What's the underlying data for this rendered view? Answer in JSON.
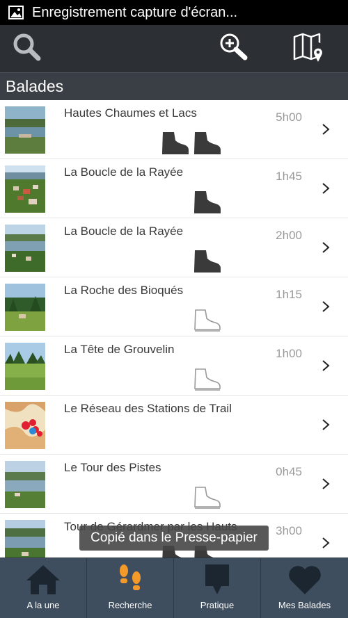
{
  "status_bar": {
    "notification": "Enregistrement capture d'écran..."
  },
  "toolbar": {
    "icons": [
      "search-icon",
      "zoom-in-icon",
      "map-icon"
    ]
  },
  "section": {
    "title": "Balades"
  },
  "walks": [
    {
      "title": "Hautes Chaumes et Lacs",
      "duration": "5h00",
      "difficulty": 2,
      "boots": [
        "filled",
        "filled"
      ],
      "thumb": "lake"
    },
    {
      "title": "La Boucle de la Rayée",
      "duration": "1h45",
      "difficulty": 1,
      "boots": [
        "filled"
      ],
      "thumb": "town"
    },
    {
      "title": "La Boucle de la Rayée",
      "duration": "2h00",
      "difficulty": 1,
      "boots": [
        "filled"
      ],
      "thumb": "lake2"
    },
    {
      "title": "La Roche des Bioqués",
      "duration": "1h15",
      "difficulty": 0,
      "boots": [
        "outline"
      ],
      "thumb": "forest"
    },
    {
      "title": "La Tête de Grouvelin",
      "duration": "1h00",
      "difficulty": 0,
      "boots": [
        "outline"
      ],
      "thumb": "meadow"
    },
    {
      "title": "Le Réseau des Stations de Trail",
      "duration": "",
      "difficulty": null,
      "boots": [],
      "thumb": "map"
    },
    {
      "title": "Le Tour des Pistes",
      "duration": "0h45",
      "difficulty": 0,
      "boots": [
        "outline"
      ],
      "thumb": "lake3"
    },
    {
      "title": "Tour de Gérardmer par les Hauts",
      "duration": "3h00",
      "difficulty": 2,
      "boots": [
        "filled",
        "filled"
      ],
      "thumb": "lake4"
    }
  ],
  "toast": {
    "message": "Copié dans le Presse-papier"
  },
  "bottom_nav": [
    {
      "label": "A la une",
      "icon": "home-icon",
      "active": false
    },
    {
      "label": "Recherche",
      "icon": "footprints-icon",
      "active": true
    },
    {
      "label": "Pratique",
      "icon": "info-bubble-icon",
      "active": false
    },
    {
      "label": "Mes Balades",
      "icon": "heart-icon",
      "active": false
    }
  ],
  "colors": {
    "active_nav": "#f39a2b",
    "nav_bg": "#3f4e5e",
    "toolbar_bg": "#2c3035",
    "icon_grey": "#b9bdc2"
  }
}
